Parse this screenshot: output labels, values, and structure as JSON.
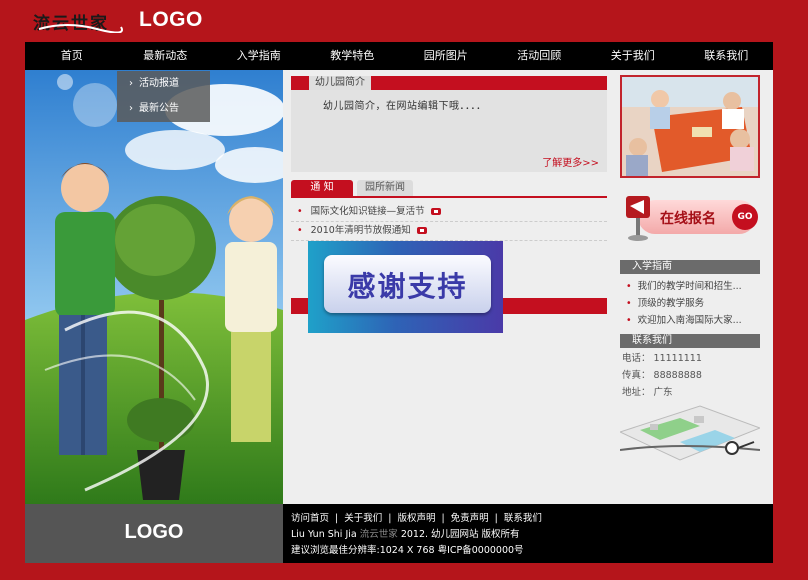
{
  "header": {
    "brand_mark_text": "流云世家",
    "logo_text": "LOGO"
  },
  "nav": [
    "首页",
    "最新动态",
    "入学指南",
    "教学特色",
    "园所图片",
    "活动回顾",
    "关于我们",
    "联系我们"
  ],
  "submenu": [
    "活动报道",
    "最新公告"
  ],
  "intro": {
    "tab_label": "幼儿园简介",
    "text": "幼儿园简介，在网站编辑下哦．．．．",
    "more_link": "了解更多>>"
  },
  "news": {
    "tabs": [
      "通 知",
      "园所新闻"
    ],
    "items": [
      "国际文化知识链接—复活节",
      "2010年清明节放假通知"
    ]
  },
  "overlay": {
    "text": "感谢支持"
  },
  "signup": {
    "label": "在线报名",
    "go": "GO"
  },
  "sidebar": {
    "guide_title": "入学指南",
    "guide_items": [
      "我们的教学时间和招生...",
      "顶级的教学服务",
      "欢迎加入南海国际大家..."
    ],
    "contact_title": "联系我们",
    "phone": "电话： 11111111",
    "fax": "传真： 88888888",
    "address": "地址： 广东"
  },
  "footer": {
    "logo_text": "LOGO",
    "links": [
      "访问首页",
      "关于我们",
      "版权声明",
      "免责声明",
      "联系我们"
    ],
    "copyright_prefix": "Liu Yun Shi Jia",
    "copyright_brand": "流云世家",
    "copyright_suffix": "2012. 幼儿园网站 版权所有",
    "resolution_line": "建议浏览最佳分辨率:1024 X 768 粤ICP备0000000号"
  },
  "colors": {
    "background_red": "#b5151b",
    "accent_red": "#c40f1f",
    "nav_black": "#000000",
    "panel_grey": "#eeeeee"
  }
}
